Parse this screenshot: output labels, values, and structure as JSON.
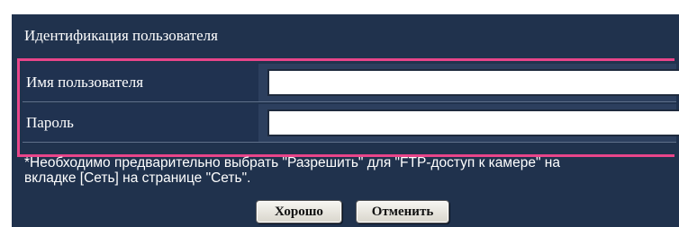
{
  "section": {
    "title": "Идентификация пользователя"
  },
  "form": {
    "username_label": "Имя пользователя",
    "username_value": "",
    "password_label": "Пароль",
    "password_value": ""
  },
  "note": {
    "line1": "*Необходимо предварительно выбрать \"Разрешить\" для \"FTP-доступ к камере\" на",
    "line2": "вкладке [Сеть] на странице \"Сеть\"."
  },
  "buttons": {
    "ok_label": "Хорошо",
    "cancel_label": "Отменить"
  },
  "colors": {
    "panel_bg": "#20324d",
    "highlight_border": "#e8458a"
  }
}
